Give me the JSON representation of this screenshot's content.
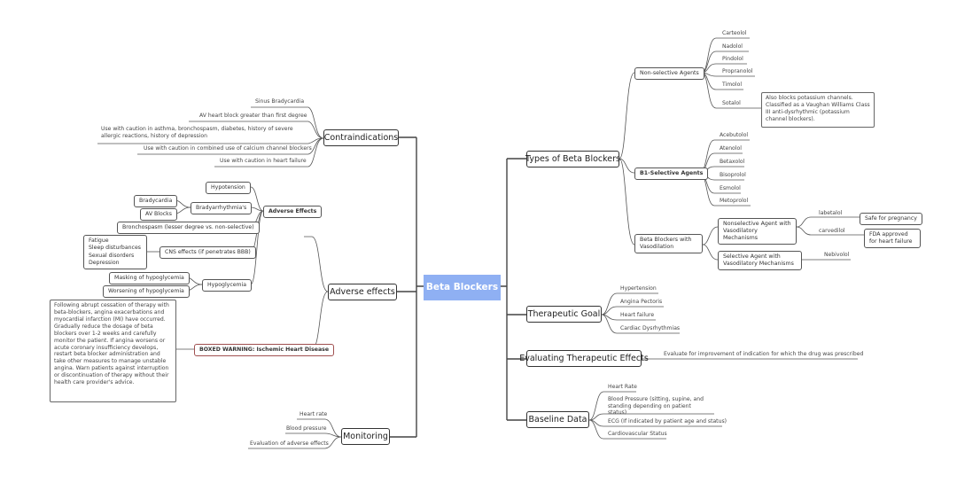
{
  "center": "Beta Blockers",
  "left": {
    "contraindications": {
      "label": "Contraindications",
      "items": [
        "Sinus Bradycardia",
        "AV heart block greater than first degree",
        "Use with caution in asthma, bronchospasm, diabetes, history of severe allergic reactions, history of depression",
        "Use with caution in combined use of calcium channel blockers",
        "Use with caution in heart failure"
      ]
    },
    "adverse": {
      "label": "Adverse effects",
      "sub_label": "Adverse Effects",
      "hypotension": "Hypotension",
      "bradyarrhythmias": "Bradyarrhythmia's",
      "bradycardia": "Bradycardia",
      "av_blocks": "AV Blocks",
      "bronchospasm": "Bronchospasm (lesser degree vs. non-selective)",
      "cns": "CNS effects (if penetrates BBB)",
      "cns_items": [
        "Fatigue",
        "Sleep disturbances",
        "Sexual disorders",
        "Depression"
      ],
      "hypoglycemia": "Hypoglycemia",
      "masking": "Masking of hypoglycemia",
      "worsening": "Worsening of hypoglycemia",
      "boxed_warning": "BOXED WARNING: Ischemic Heart Disease",
      "boxed_text": "Following abrupt cessation of therapy with beta-blockers, angina exacerbations and myocardial infarction (MI) have occurred. Gradually reduce the dosage of beta blockers over 1-2 weeks and carefully monitor the patient. If angina worsens or acute coronary insufficiency develops, restart beta blocker administration and take other measures to manage unstable angina. Warn patients against interruption or discontinuation of therapy without their health care provider's advice."
    },
    "monitoring": {
      "label": "Monitoring",
      "items": [
        "Heart rate",
        "Blood pressure",
        "Evaluation of adverse effects"
      ]
    }
  },
  "right": {
    "types": {
      "label": "Types of Beta Blockers",
      "nonselective": {
        "label": "Non-selective Agents",
        "items": [
          "Carteolol",
          "Nadolol",
          "Pindolol",
          "Propranolol",
          "Timolol",
          "Sotalol"
        ],
        "sotalol_note": "Also blocks potassium channels. Classified as a Vaughan Williams Class III anti-dysrhythmic (potassium channel blockers)."
      },
      "b1": {
        "label": "B1-Selective Agents",
        "items": [
          "Acebutolol",
          "Atenolol",
          "Betaxolol",
          "Bisoprolol",
          "Esmolol",
          "Metoprolol"
        ]
      },
      "vaso": {
        "label": "Beta Blockers with Vasodilation",
        "nonselective_label": "Nonselective Agent with Vasodilatory Mechanisms",
        "labetalol": "labetalol",
        "labetalol_note": "Safe for pregnancy",
        "carvedilol": "carvedilol",
        "carvedilol_note": "FDA approved for heart failure",
        "selective_label": "Selective Agent with Vasodilatory Mechanisms",
        "nebivolol": "Nebivolol"
      }
    },
    "goal": {
      "label": "Therapeutic Goal",
      "items": [
        "Hypertension",
        "Angina Pectoris",
        "Heart failure",
        "Cardiac Dysrhythmias"
      ]
    },
    "evaluating": {
      "label": "Evaluating Therapeutic Effects",
      "item": "Evaluate for improvement of indication for which the drug was prescribed"
    },
    "baseline": {
      "label": "Baseline Data",
      "items": [
        "Heart Rate",
        "Blood Pressure (sitting, supine, and standing depending on patient status)",
        "ECG (If indicated by patient age and status)",
        "Cardiovascular Status"
      ]
    }
  }
}
